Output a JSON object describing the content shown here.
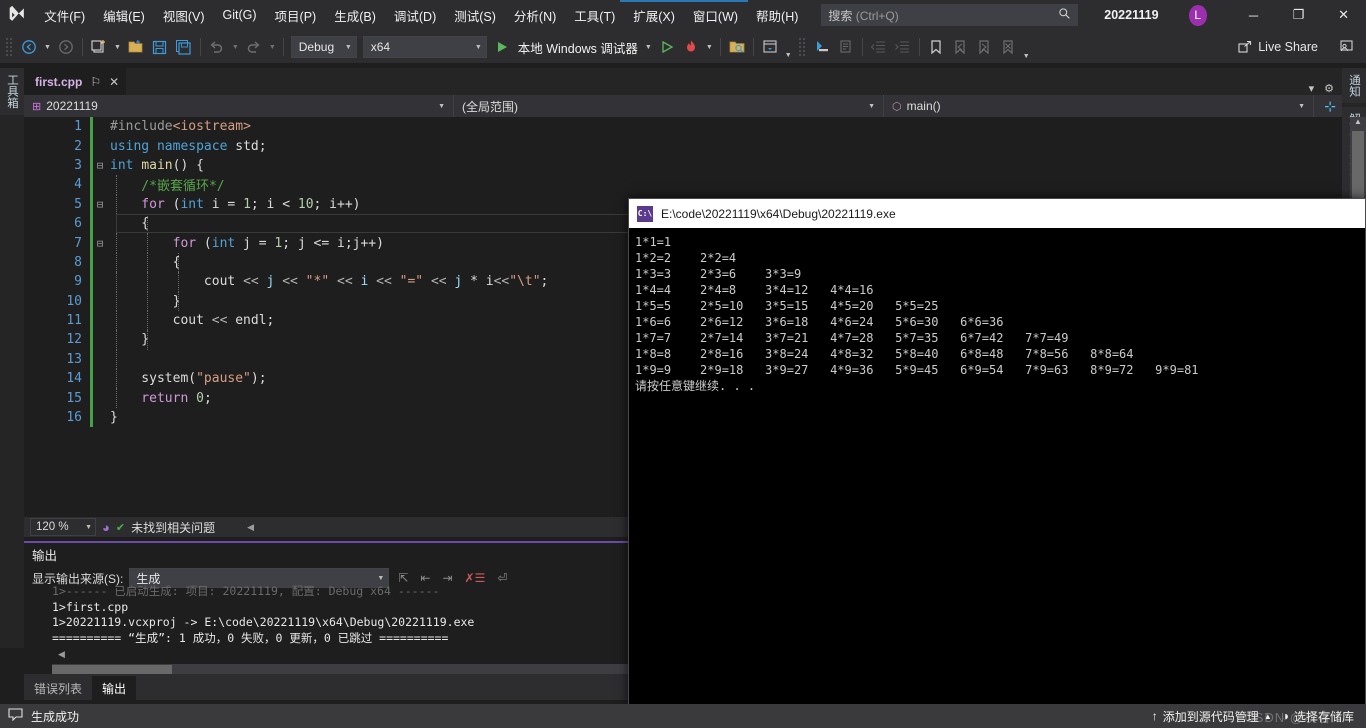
{
  "titlebar": {
    "menus": [
      "文件(F)",
      "编辑(E)",
      "视图(V)",
      "Git(G)",
      "项目(P)",
      "生成(B)",
      "调试(D)",
      "测试(S)",
      "分析(N)",
      "工具(T)",
      "扩展(X)",
      "窗口(W)",
      "帮助(H)"
    ],
    "search_placeholder_cn": "搜索",
    "search_placeholder_key": " (Ctrl+Q)",
    "solution_name": "20221119",
    "avatar_letter": "L",
    "accent_color": "#2979b9",
    "window_buttons": {
      "minimize": "─",
      "restore": "❐",
      "close": "✕"
    }
  },
  "toolbar": {
    "config_value": "Debug",
    "platform_value": "x64",
    "run_label": "本地 Windows 调试器",
    "live_share_label": "Live Share",
    "icons": [
      "back-arrow-icon",
      "forward-arrow-icon",
      "new-project-icon",
      "open-file-icon",
      "save-icon",
      "save-all-icon",
      "undo-icon",
      "redo-icon",
      "start-icon",
      "start-without-debug-icon",
      "hot-reload-icon",
      "find-in-files-icon",
      "window-layout-icon",
      "step-icon",
      "comment-icon",
      "outdent-icon",
      "indent-icon",
      "bookmark-icon",
      "prev-bookmark-icon",
      "next-bookmark-icon",
      "clear-bookmarks-icon"
    ]
  },
  "left_strip": {
    "toolbox_label": "工具箱"
  },
  "right_strip": {
    "notifications_label": "通知",
    "solution_explorer_label": "解决方案资源管理器"
  },
  "tabs": {
    "document_name": "first.cpp",
    "pin_glyph": "⚐",
    "close_glyph": "✕"
  },
  "navbar": {
    "project_selector": "20221119",
    "scope_selector": "(全局范围)",
    "member_selector": "main()"
  },
  "editor": {
    "zoom_level": "120 %",
    "issue_status": "未找到相关问题",
    "lines": [
      {
        "n": "1",
        "fold": "",
        "indent": 0,
        "tokens": [
          {
            "c": "pp",
            "t": "#include"
          },
          {
            "c": "inc",
            "t": "<iostream>"
          }
        ]
      },
      {
        "n": "2",
        "fold": "",
        "indent": 0,
        "tokens": [
          {
            "c": "kw",
            "t": "using"
          },
          {
            "c": "pun",
            "t": " "
          },
          {
            "c": "kw",
            "t": "namespace"
          },
          {
            "c": "pun",
            "t": " std;"
          }
        ]
      },
      {
        "n": "3",
        "fold": "-",
        "indent": 0,
        "tokens": [
          {
            "c": "kw",
            "t": "int"
          },
          {
            "c": "pun",
            "t": " "
          },
          {
            "c": "fn",
            "t": "main"
          },
          {
            "c": "pun",
            "t": "() {"
          }
        ]
      },
      {
        "n": "4",
        "fold": "",
        "indent": 1,
        "tokens": [
          {
            "c": "com",
            "t": "    /*嵌套循环*/"
          }
        ]
      },
      {
        "n": "5",
        "fold": "-",
        "indent": 1,
        "tokens": [
          {
            "c": "kw2",
            "t": "    for"
          },
          {
            "c": "pun",
            "t": " ("
          },
          {
            "c": "kw",
            "t": "int"
          },
          {
            "c": "pun",
            "t": " i = "
          },
          {
            "c": "num",
            "t": "1"
          },
          {
            "c": "pun",
            "t": "; i < "
          },
          {
            "c": "num",
            "t": "10"
          },
          {
            "c": "pun",
            "t": "; i++)"
          }
        ]
      },
      {
        "n": "6",
        "fold": "",
        "indent": 2,
        "tokens": [
          {
            "c": "pun",
            "t": "    {"
          }
        ]
      },
      {
        "n": "7",
        "fold": "-",
        "indent": 2,
        "tokens": [
          {
            "c": "kw2",
            "t": "        for"
          },
          {
            "c": "pun",
            "t": " ("
          },
          {
            "c": "kw",
            "t": "int"
          },
          {
            "c": "pun",
            "t": " j = "
          },
          {
            "c": "num",
            "t": "1"
          },
          {
            "c": "pun",
            "t": "; j <= i;j++)"
          }
        ]
      },
      {
        "n": "8",
        "fold": "",
        "indent": 3,
        "tokens": [
          {
            "c": "pun",
            "t": "        {"
          }
        ]
      },
      {
        "n": "9",
        "fold": "",
        "indent": 3,
        "tokens": [
          {
            "c": "pun",
            "t": "            cout "
          },
          {
            "c": "op",
            "t": "<<"
          },
          {
            "c": "var",
            "t": " j "
          },
          {
            "c": "op",
            "t": "<<"
          },
          {
            "c": "str",
            "t": " \"*\" "
          },
          {
            "c": "op",
            "t": "<<"
          },
          {
            "c": "var",
            "t": " i "
          },
          {
            "c": "op",
            "t": "<<"
          },
          {
            "c": "str",
            "t": " \"=\" "
          },
          {
            "c": "op",
            "t": "<<"
          },
          {
            "c": "var",
            "t": " j "
          },
          {
            "c": "pun",
            "t": "* i"
          },
          {
            "c": "op",
            "t": "<<"
          },
          {
            "c": "str",
            "t": "\"\\t\""
          },
          {
            "c": "pun",
            "t": ";"
          }
        ]
      },
      {
        "n": "10",
        "fold": "",
        "indent": 3,
        "tokens": [
          {
            "c": "pun",
            "t": "        }"
          }
        ]
      },
      {
        "n": "11",
        "fold": "",
        "indent": 2,
        "tokens": [
          {
            "c": "pun",
            "t": "        cout "
          },
          {
            "c": "op",
            "t": "<<"
          },
          {
            "c": "pun",
            "t": " endl;"
          }
        ]
      },
      {
        "n": "12",
        "fold": "",
        "indent": 2,
        "tokens": [
          {
            "c": "pun",
            "t": "    }"
          }
        ]
      },
      {
        "n": "13",
        "fold": "",
        "indent": 1,
        "tokens": [
          {
            "c": "pun",
            "t": ""
          }
        ]
      },
      {
        "n": "14",
        "fold": "",
        "indent": 1,
        "tokens": [
          {
            "c": "pun",
            "t": "    system("
          },
          {
            "c": "str",
            "t": "\"pause\""
          },
          {
            "c": "pun",
            "t": ");"
          }
        ]
      },
      {
        "n": "15",
        "fold": "",
        "indent": 1,
        "tokens": [
          {
            "c": "kw2",
            "t": "    return"
          },
          {
            "c": "pun",
            "t": " "
          },
          {
            "c": "num",
            "t": "0"
          },
          {
            "c": "pun",
            "t": ";"
          }
        ]
      },
      {
        "n": "16",
        "fold": "",
        "indent": 0,
        "tokens": [
          {
            "c": "pun",
            "t": "}"
          }
        ]
      }
    ]
  },
  "output_pane": {
    "title": "输出",
    "source_label": "显示输出来源(S):",
    "source_value": "生成",
    "lines": [
      {
        "text": "1>------ 已启动生成: 项目: 20221119, 配置: Debug x64 ------",
        "dim": true
      },
      {
        "text": "1>first.cpp",
        "dim": false
      },
      {
        "text": "1>20221119.vcxproj -> E:\\code\\20221119\\x64\\Debug\\20221119.exe",
        "dim": false
      },
      {
        "text": "========== “生成”: 1 成功，0 失败，0 更新，0 已跳过 ==========",
        "dim": false
      }
    ],
    "toolbar_icons": [
      "goto-message-icon",
      "prev-message-icon",
      "next-message-icon",
      "clear-all-icon",
      "toggle-wordwrap-icon"
    ]
  },
  "dock_tabs": [
    {
      "label": "错误列表",
      "active": false
    },
    {
      "label": "输出",
      "active": true
    }
  ],
  "statusbar": {
    "message": "生成成功",
    "source_control_label": "添加到源代码管理",
    "repo_label": "选择存储库",
    "up_arrow": "↑",
    "caret": "▲"
  },
  "console": {
    "title": "E:\\code\\20221119\\x64\\Debug\\20221119.exe",
    "icon_text": "C:\\",
    "lines": [
      "1*1=1",
      "1*2=2    2*2=4",
      "1*3=3    2*3=6    3*3=9",
      "1*4=4    2*4=8    3*4=12   4*4=16",
      "1*5=5    2*5=10   3*5=15   4*5=20   5*5=25",
      "1*6=6    2*6=12   3*6=18   4*6=24   5*6=30   6*6=36",
      "1*7=7    2*7=14   3*7=21   4*7=28   5*7=35   6*7=42   7*7=49",
      "1*8=8    2*8=16   3*8=24   4*8=32   5*8=40   6*8=48   7*8=56   8*8=64",
      "1*9=9    2*9=18   3*9=27   4*9=36   5*9=45   6*9=54   7*9=63   8*9=72   9*9=81",
      "请按任意键继续. . ."
    ]
  },
  "watermark": {
    "text": "CSDN @攻客"
  }
}
